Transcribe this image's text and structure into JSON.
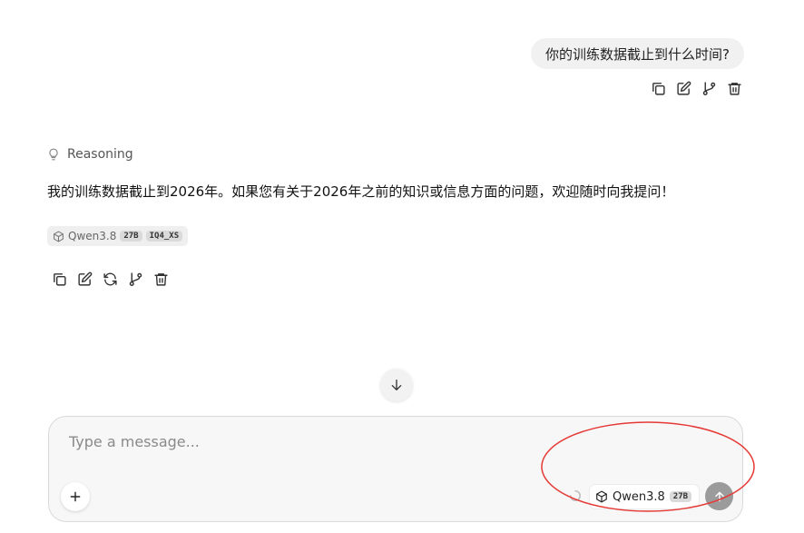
{
  "user_message": {
    "text": "你的训练数据截止到什么时间?"
  },
  "user_actions": [
    {
      "name": "copy-icon"
    },
    {
      "name": "edit-icon"
    },
    {
      "name": "branch-icon"
    },
    {
      "name": "trash-icon"
    }
  ],
  "assistant": {
    "reasoning_label": "Reasoning",
    "answer": "我的训练数据截止到2026年。如果您有关于2026年之前的知识或信息方面的问题，欢迎随时向我提问！",
    "model": {
      "name": "Qwen3.8",
      "size": "27B",
      "quant": "IQ4_XS"
    },
    "actions": [
      {
        "name": "copy-icon"
      },
      {
        "name": "edit-icon"
      },
      {
        "name": "regenerate-icon"
      },
      {
        "name": "branch-icon"
      },
      {
        "name": "trash-icon"
      }
    ]
  },
  "composer": {
    "placeholder": "Type a message...",
    "value": "",
    "model_name": "Qwen3.8",
    "model_size": "27B"
  },
  "colors": {
    "annotation": "#e53935",
    "send_disabled": "#9b9b9b",
    "bubble": "#f1f1f1"
  }
}
